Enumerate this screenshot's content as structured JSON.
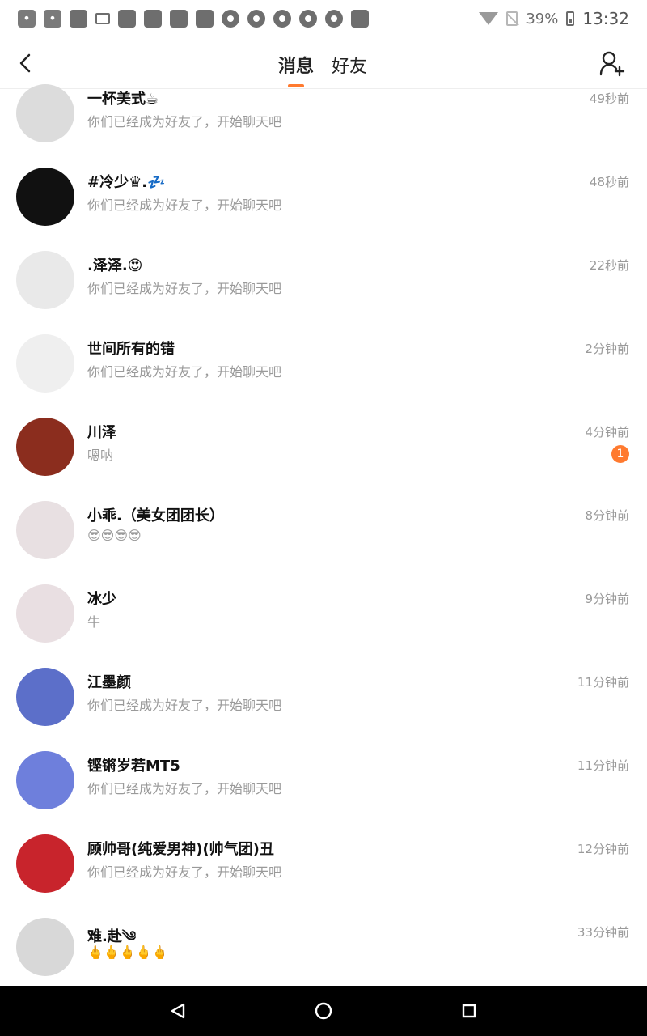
{
  "status_bar": {
    "battery_percent": "39%",
    "time": "13:32",
    "icons": [
      "paw-icon",
      "paw-icon",
      "square-icon",
      "sim-icon",
      "square-icon",
      "square-icon",
      "square-icon",
      "square-icon",
      "circle-icon",
      "circle-icon",
      "circle-icon",
      "circle-icon",
      "circle-icon",
      "image-icon",
      "wifi-icon",
      "no-sim-icon",
      "battery-icon"
    ]
  },
  "header": {
    "tabs": [
      {
        "label": "消息",
        "active": true
      },
      {
        "label": "好友",
        "active": false
      }
    ]
  },
  "chats": [
    {
      "name": "一杯美式☕",
      "preview": "你们已经成为好友了，开始聊天吧",
      "time": "49秒前",
      "badge": null,
      "avatar_color": "#dcdcdc"
    },
    {
      "name": "#冷少♛.💤",
      "preview": "你们已经成为好友了，开始聊天吧",
      "time": "48秒前",
      "badge": null,
      "avatar_color": "#111111"
    },
    {
      "name": ".泽泽.😍",
      "preview": "你们已经成为好友了，开始聊天吧",
      "time": "22秒前",
      "badge": null,
      "avatar_color": "#e9e9e9"
    },
    {
      "name": "世间所有的错",
      "preview": "你们已经成为好友了，开始聊天吧",
      "time": "2分钟前",
      "badge": null,
      "avatar_color": "#efefef"
    },
    {
      "name": "川泽",
      "preview": "嗯呐",
      "time": "4分钟前",
      "badge": "1",
      "avatar_color": "#8b2d1e"
    },
    {
      "name": "小乖.（美女团团长）",
      "preview": "😎😎😎😎",
      "time": "8分钟前",
      "badge": null,
      "avatar_color": "#e8e0e2"
    },
    {
      "name": "冰少",
      "preview": "牛",
      "time": "9分钟前",
      "badge": null,
      "avatar_color": "#e9dfe2"
    },
    {
      "name": "江墨颜",
      "preview": "你们已经成为好友了，开始聊天吧",
      "time": "11分钟前",
      "badge": null,
      "avatar_color": "#5c6fc9"
    },
    {
      "name": "铿锵岁若MT5",
      "preview": "你们已经成为好友了，开始聊天吧",
      "time": "11分钟前",
      "badge": null,
      "avatar_color": "#6e7fdc"
    },
    {
      "name": "顾帅哥(纯爱男神)(帅气团)丑",
      "preview": "你们已经成为好友了，开始聊天吧",
      "time": "12分钟前",
      "badge": null,
      "avatar_color": "#c8242c"
    },
    {
      "name": "难.赴༄",
      "preview": "🖕🖕🖕🖕🖕",
      "time": "33分钟前",
      "badge": null,
      "avatar_color": "#d8d8d8"
    }
  ],
  "colors": {
    "accent": "#ff7a2f",
    "muted_text": "#9a9a9a",
    "nav_bar": "#000000"
  }
}
